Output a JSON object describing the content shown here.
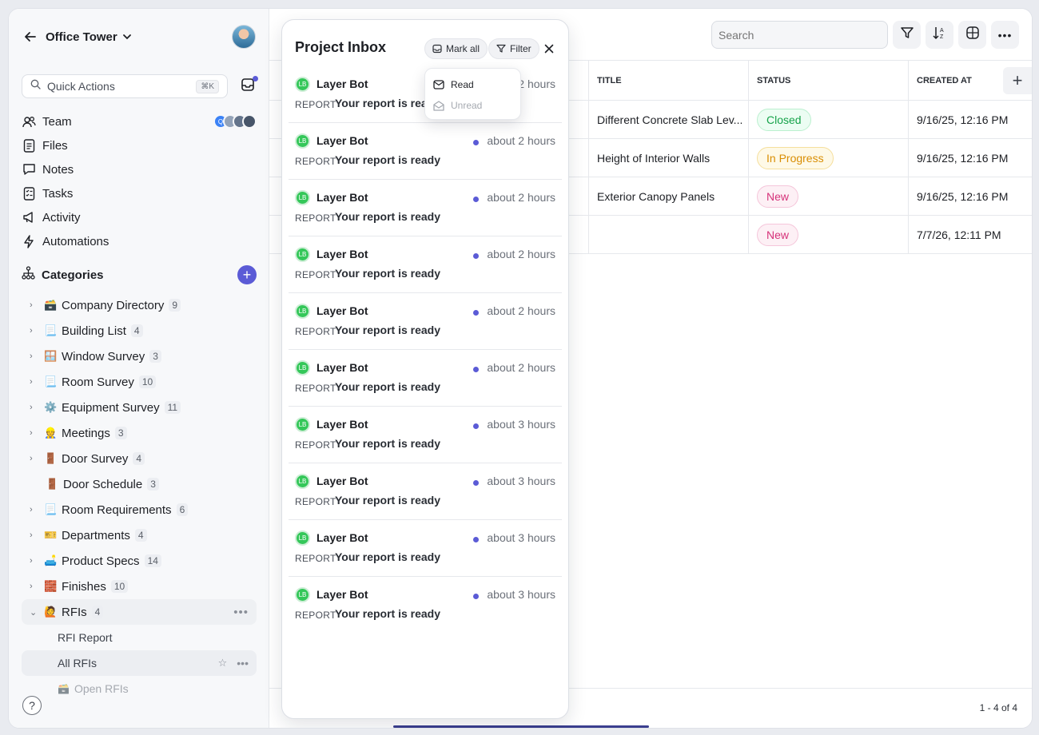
{
  "project": {
    "title": "Office Tower"
  },
  "sidebar": {
    "search_label": "Quick Actions",
    "search_shortcut": "⌘K",
    "nav": [
      {
        "label": "Team"
      },
      {
        "label": "Files"
      },
      {
        "label": "Notes"
      },
      {
        "label": "Tasks"
      },
      {
        "label": "Activity"
      },
      {
        "label": "Automations"
      }
    ],
    "team_avatar_initial": "Q",
    "categories_label": "Categories",
    "categories": [
      {
        "emoji": "🗃️",
        "label": "Company Directory",
        "count": "9"
      },
      {
        "emoji": "📃",
        "label": "Building List",
        "count": "4"
      },
      {
        "emoji": "🪟",
        "label": "Window Survey",
        "count": "3"
      },
      {
        "emoji": "📃",
        "label": "Room Survey",
        "count": "10"
      },
      {
        "emoji": "⚙️",
        "label": "Equipment Survey",
        "count": "11"
      },
      {
        "emoji": "👷",
        "label": "Meetings",
        "count": "3"
      },
      {
        "emoji": "🚪",
        "label": "Door Survey",
        "count": "4"
      },
      {
        "emoji": "🚪",
        "label": "Door Schedule",
        "count": "3"
      },
      {
        "emoji": "📃",
        "label": "Room Requirements",
        "count": "6"
      },
      {
        "emoji": "🎫",
        "label": "Departments",
        "count": "4"
      },
      {
        "emoji": "🛋️",
        "label": "Product Specs",
        "count": "14"
      },
      {
        "emoji": "🧱",
        "label": "Finishes",
        "count": "10"
      },
      {
        "emoji": "🙋",
        "label": "RFIs",
        "count": "4"
      }
    ],
    "rfi_children": [
      {
        "label": "RFI Report"
      },
      {
        "label": "All RFIs"
      },
      {
        "emoji": "🗃️",
        "label": "Open RFIs"
      }
    ],
    "help": "?"
  },
  "main": {
    "search_placeholder": "Search",
    "columns": [
      "TITLE",
      "STATUS",
      "CREATED AT"
    ],
    "rows": [
      {
        "title": "Different Concrete Slab Lev...",
        "status": "Closed",
        "created": "9/16/25, 12:16 PM"
      },
      {
        "title": "Height of Interior Walls",
        "status": "In Progress",
        "created": "9/16/25, 12:16 PM"
      },
      {
        "title": "Exterior Canopy Panels",
        "status": "New",
        "created": "9/16/25, 12:16 PM"
      },
      {
        "title": "",
        "status": "New",
        "created": "7/7/26, 12:11 PM"
      }
    ],
    "pager": "1 - 4 of 4"
  },
  "inbox": {
    "title": "Project Inbox",
    "mark_all": "Mark all",
    "filter": "Filter",
    "menu": {
      "read": "Read",
      "unread": "Unread"
    },
    "notifications": [
      {
        "initials": "LB",
        "sender": "Layer Bot",
        "time": "about 2 hours",
        "kind": "REPORT",
        "message": "Your report is ready"
      },
      {
        "initials": "LB",
        "sender": "Layer Bot",
        "time": "about 2 hours",
        "kind": "REPORT",
        "message": "Your report is ready"
      },
      {
        "initials": "LB",
        "sender": "Layer Bot",
        "time": "about 2 hours",
        "kind": "REPORT",
        "message": "Your report is ready"
      },
      {
        "initials": "LB",
        "sender": "Layer Bot",
        "time": "about 2 hours",
        "kind": "REPORT",
        "message": "Your report is ready"
      },
      {
        "initials": "LB",
        "sender": "Layer Bot",
        "time": "about 2 hours",
        "kind": "REPORT",
        "message": "Your report is ready"
      },
      {
        "initials": "LB",
        "sender": "Layer Bot",
        "time": "about 2 hours",
        "kind": "REPORT",
        "message": "Your report is ready"
      },
      {
        "initials": "LB",
        "sender": "Layer Bot",
        "time": "about 3 hours",
        "kind": "REPORT",
        "message": "Your report is ready"
      },
      {
        "initials": "LB",
        "sender": "Layer Bot",
        "time": "about 3 hours",
        "kind": "REPORT",
        "message": "Your report is ready"
      },
      {
        "initials": "LB",
        "sender": "Layer Bot",
        "time": "about 3 hours",
        "kind": "REPORT",
        "message": "Your report is ready"
      },
      {
        "initials": "LB",
        "sender": "Layer Bot",
        "time": "about 3 hours",
        "kind": "REPORT",
        "message": "Your report is ready"
      }
    ]
  },
  "colors": {
    "accent": "#5b5bd6",
    "status_closed": "#16a34a",
    "status_in_progress": "#d98e04",
    "status_new": "#d6337a"
  }
}
